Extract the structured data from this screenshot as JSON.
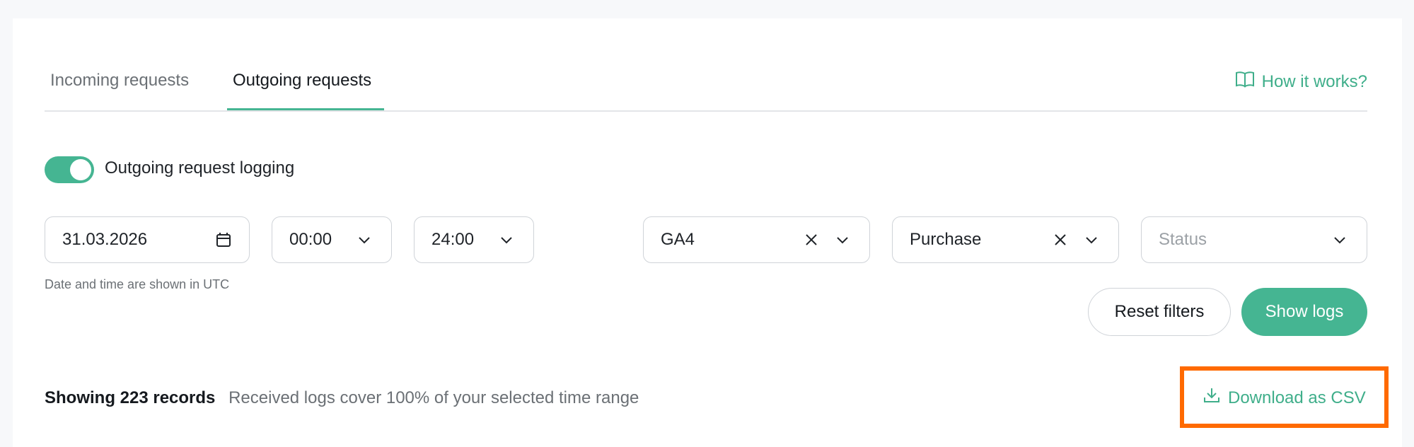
{
  "tabs": [
    {
      "label": "Incoming requests",
      "active": false
    },
    {
      "label": "Outgoing requests",
      "active": true
    }
  ],
  "help_link": {
    "label": "How it works?",
    "icon": "book-icon"
  },
  "logging_toggle": {
    "label": "Outgoing request logging",
    "on": true
  },
  "filters": {
    "date": {
      "value": "31.03.2026",
      "icon": "calendar-icon"
    },
    "time_from": {
      "value": "00:00"
    },
    "time_to": {
      "value": "24:00"
    },
    "destination": {
      "value": "GA4"
    },
    "event": {
      "value": "Purchase"
    },
    "status": {
      "placeholder": "Status"
    },
    "hint": "Date and time are shown in UTC"
  },
  "actions": {
    "reset_label": "Reset filters",
    "show_label": "Show logs"
  },
  "summary": {
    "records": "Showing 223 records",
    "coverage": "Received logs cover 100% of your selected time range"
  },
  "download": {
    "label": "Download as CSV",
    "icon": "download-icon"
  },
  "colors": {
    "accent": "#45b592",
    "highlight": "#ff6a00"
  }
}
